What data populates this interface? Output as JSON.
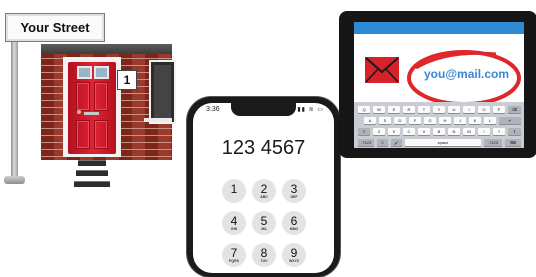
{
  "street_sign": {
    "text": "Your Street"
  },
  "house": {
    "number": "1"
  },
  "phone": {
    "status_time": "3:36",
    "status_icons": "▮▮ ≋ ▭",
    "dialed_number": "123 4567",
    "keypad": [
      {
        "digit": "1",
        "letters": ""
      },
      {
        "digit": "2",
        "letters": "ABC"
      },
      {
        "digit": "3",
        "letters": "DEF"
      },
      {
        "digit": "4",
        "letters": "GHI"
      },
      {
        "digit": "5",
        "letters": "JKL"
      },
      {
        "digit": "6",
        "letters": "MNO"
      },
      {
        "digit": "7",
        "letters": "PQRS"
      },
      {
        "digit": "8",
        "letters": "TUV"
      },
      {
        "digit": "9",
        "letters": "WXYZ"
      }
    ]
  },
  "tablet": {
    "email": "you@mail.com",
    "envelope_icon": "envelope-icon",
    "ring_color": "#e0262b",
    "keyboard": {
      "row1": [
        "Q",
        "W",
        "E",
        "R",
        "T",
        "Y",
        "U",
        "I",
        "O",
        "P",
        "⌫"
      ],
      "row2": [
        "A",
        "S",
        "D",
        "F",
        "G",
        "H",
        "J",
        "K",
        "L",
        "↵"
      ],
      "row3": [
        "⇧",
        "Z",
        "X",
        "C",
        "V",
        "B",
        "N",
        "M",
        "!",
        "?",
        "⇧"
      ],
      "row4": [
        ".?123",
        "☺",
        "🎤",
        "space",
        ".?123",
        "⌨"
      ]
    }
  }
}
